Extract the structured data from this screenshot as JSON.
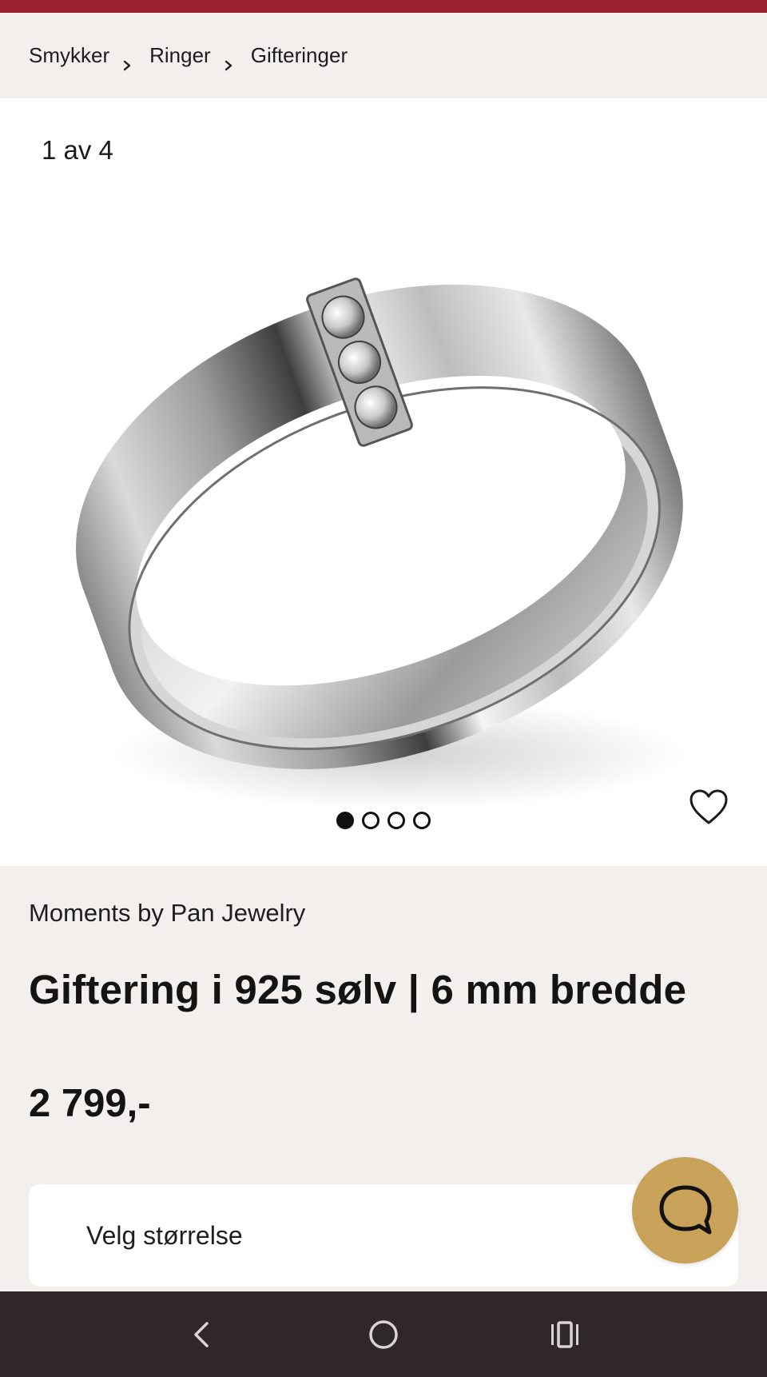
{
  "colors": {
    "top_stripe": "#9b2030",
    "page_bg": "#f2efed",
    "gallery_bg": "#ffffff",
    "chat_button": "#c9a25a",
    "nav_bar": "#2f272b"
  },
  "breadcrumb": {
    "items": [
      "Smykker",
      "Ringer",
      "Gifteringer"
    ],
    "separator_icon": "chevron-right-icon"
  },
  "gallery": {
    "counter": "1 av 4",
    "total_images": 4,
    "active_index": 1,
    "wishlist_icon": "heart-outline-icon"
  },
  "product": {
    "brand": "Moments by Pan Jewelry",
    "title": "Giftering i 925 sølv | 6 mm bredde",
    "price": "2 799,-"
  },
  "size_selector": {
    "label": "Velg størrelse"
  },
  "chat": {
    "icon": "chat-bubble-icon"
  },
  "system_nav": {
    "back_icon": "back-icon",
    "home_icon": "home-icon",
    "recents_icon": "recents-icon"
  }
}
